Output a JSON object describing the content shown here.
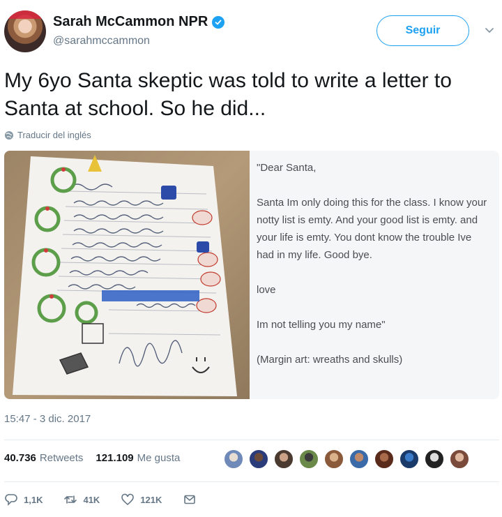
{
  "author": {
    "name": "Sarah McCammon NPR",
    "handle": "@sarahmccammon",
    "verified": true
  },
  "follow_label": "Seguir",
  "tweet_text": "My 6yo Santa skeptic was told to write a letter to Santa at school. So he did...",
  "translate_label": "Traducir del inglés",
  "transcript": {
    "greeting": "\"Dear Santa,",
    "body": "Santa Im only doing this for the class. I know your notty list is emty. And your good list is emty. and your life is emty. You dont know the trouble Ive had in my life. Good bye.",
    "closing": "love",
    "signature": "Im not telling you my name\"",
    "note": "(Margin art: wreaths and skulls)"
  },
  "timestamp": "15:47 - 3 dic. 2017",
  "stats": {
    "retweets_count": "40.736",
    "retweets_label": "Retweets",
    "likes_count": "121.109",
    "likes_label": "Me gusta"
  },
  "actions": {
    "replies": "1,1K",
    "retweets": "41K",
    "likes": "121K"
  },
  "colors": {
    "accent": "#1da1f2",
    "secondary_text": "#657786",
    "divider": "#e6ecf0"
  },
  "icons": {
    "verified": "verified-check-icon",
    "globe": "globe-icon",
    "reply": "reply-icon",
    "retweet": "retweet-icon",
    "like": "heart-icon",
    "message": "envelope-icon",
    "caret": "chevron-down-icon"
  }
}
